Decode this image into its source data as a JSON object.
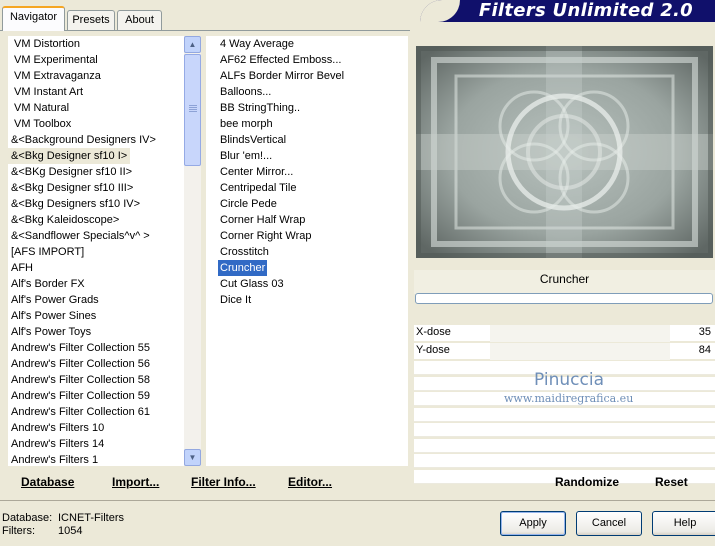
{
  "tabs": [
    {
      "label": "Navigator",
      "active": true
    },
    {
      "label": "Presets",
      "active": false
    },
    {
      "label": "About",
      "active": false
    }
  ],
  "app_title": "Filters Unlimited 2.0",
  "categories": [
    "VM Distortion",
    "VM Experimental",
    "VM Extravaganza",
    "VM Instant Art",
    "VM Natural",
    "VM Toolbox",
    "&<Background Designers IV>",
    "&<Bkg Designer sf10 I>",
    "&<BKg Designer sf10 II>",
    "&<Bkg Designer sf10 III>",
    "&<Bkg Designers sf10 IV>",
    "&<Bkg Kaleidoscope>",
    "&<Sandflower Specials^v^ >",
    "[AFS IMPORT]",
    "AFH",
    "Alf's Border FX",
    "Alf's Power Grads",
    "Alf's Power Sines",
    "Alf's Power Toys",
    "Andrew's Filter Collection 55",
    "Andrew's Filter Collection 56",
    "Andrew's Filter Collection 58",
    "Andrew's Filter Collection 59",
    "Andrew's Filter Collection 61",
    "Andrew's Filters 10",
    "Andrew's Filters 14",
    "Andrew's Filters 1"
  ],
  "selected_category_index": 7,
  "filters": [
    "4 Way Average",
    "AF62 Effected Emboss...",
    "ALFs Border Mirror Bevel",
    "Balloons...",
    "BB StringThing..",
    "bee morph",
    "BlindsVertical",
    "Blur 'em!...",
    "Center Mirror...",
    "Centripedal Tile",
    "Circle Pede",
    "Corner Half Wrap",
    "Corner Right Wrap",
    "Crosstitch",
    "Cruncher",
    "Cut Glass 03",
    "Dice It"
  ],
  "selected_filter_index": 14,
  "current_filter": "Cruncher",
  "params": [
    {
      "label": "X-dose",
      "value": "35",
      "level": 35
    },
    {
      "label": "Y-dose",
      "value": "84",
      "level": 84
    }
  ],
  "watermark": {
    "line1": "Pinuccia",
    "line2": "www.maidiregrafica.eu"
  },
  "links": {
    "database": "Database",
    "import": "Import...",
    "filter_info": "Filter Info...",
    "editor": "Editor...",
    "randomize": "Randomize",
    "reset": "Reset"
  },
  "info": {
    "database_label": "Database:",
    "database_value": "ICNET-Filters",
    "filters_label": "Filters:",
    "filters_value": "1054"
  },
  "buttons": {
    "apply": "Apply",
    "cancel": "Cancel",
    "help": "Help"
  },
  "colors": {
    "selection": "#316ac5",
    "banner": "#10106b",
    "watermark": "#6f8fb8"
  }
}
